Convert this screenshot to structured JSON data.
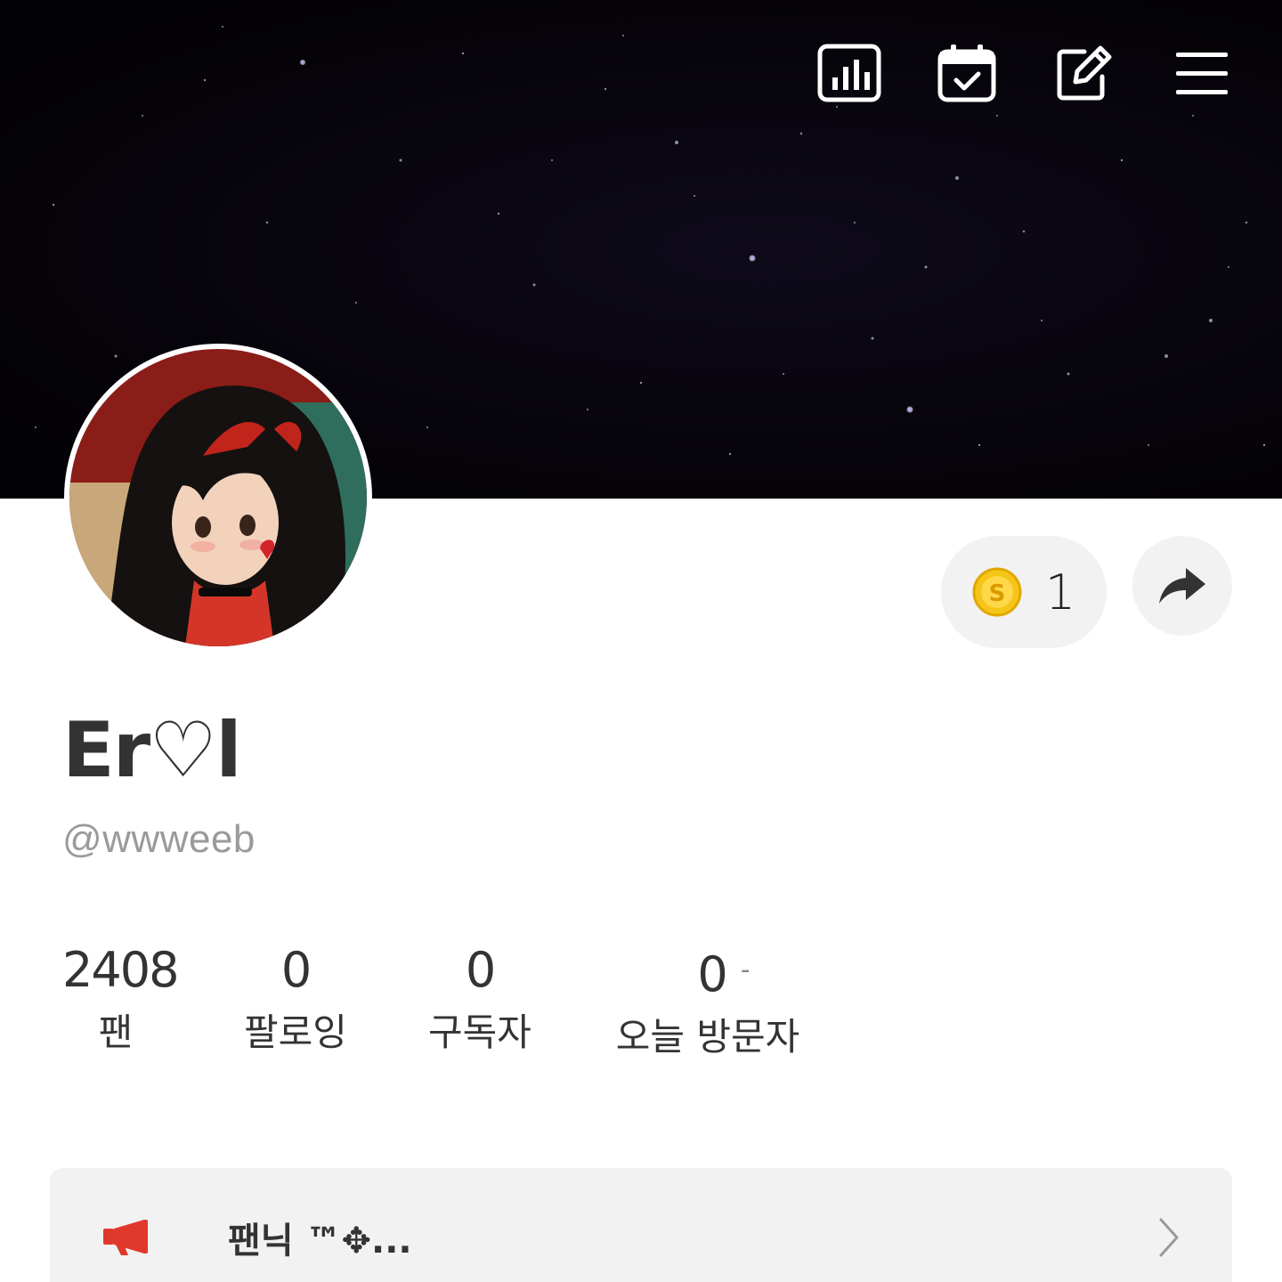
{
  "profile": {
    "name": "Er♡l",
    "handle": "@wwweeb"
  },
  "coin": {
    "count": "1",
    "symbol": "S"
  },
  "stats": [
    {
      "value": "2408",
      "label": "팬"
    },
    {
      "value": "0",
      "label": "팔로잉"
    },
    {
      "value": "0",
      "label": "구독자"
    },
    {
      "value": "0",
      "label": "오늘 방문자",
      "trend": "-"
    }
  ],
  "notice": {
    "text": "팬닉 ™✥..."
  },
  "icons": {
    "stats": "bar-chart-icon",
    "calendar": "calendar-check-icon",
    "edit": "edit-icon",
    "menu": "hamburger-menu-icon",
    "share": "share-arrow-icon",
    "coin": "coin-icon",
    "notice": "megaphone-icon",
    "chevron": "chevron-right-icon"
  },
  "colors": {
    "accent": "#e0382c",
    "coin": "#f5c518",
    "cover": "#050308",
    "pill": "#f2f2f2"
  }
}
